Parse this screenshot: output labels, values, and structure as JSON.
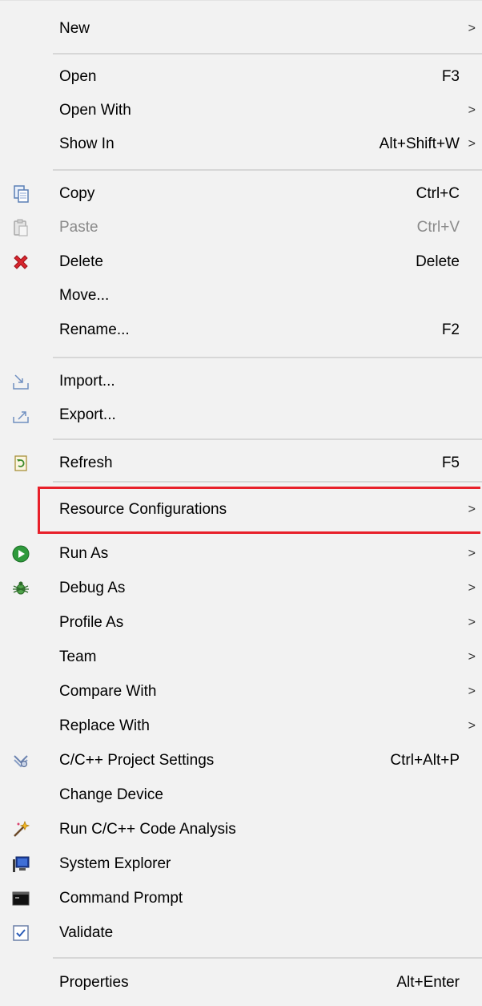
{
  "menu": {
    "items": [
      {
        "label": "New",
        "shortcut": "",
        "submenu": true,
        "icon": null
      },
      {
        "label": "Open",
        "shortcut": "F3",
        "submenu": false,
        "icon": null
      },
      {
        "label": "Open With",
        "shortcut": "",
        "submenu": true,
        "icon": null
      },
      {
        "label": "Show In",
        "shortcut": "Alt+Shift+W",
        "submenu": true,
        "icon": null
      },
      {
        "label": "Copy",
        "shortcut": "Ctrl+C",
        "submenu": false,
        "icon": "copy-icon"
      },
      {
        "label": "Paste",
        "shortcut": "Ctrl+V",
        "submenu": false,
        "icon": "paste-icon",
        "disabled": true
      },
      {
        "label": "Delete",
        "shortcut": "Delete",
        "submenu": false,
        "icon": "delete-icon"
      },
      {
        "label": "Move...",
        "shortcut": "",
        "submenu": false,
        "icon": null
      },
      {
        "label": "Rename...",
        "shortcut": "F2",
        "submenu": false,
        "icon": null
      },
      {
        "label": "Import...",
        "shortcut": "",
        "submenu": false,
        "icon": "import-icon"
      },
      {
        "label": "Export...",
        "shortcut": "",
        "submenu": false,
        "icon": "export-icon"
      },
      {
        "label": "Refresh",
        "shortcut": "F5",
        "submenu": false,
        "icon": "refresh-icon"
      },
      {
        "label": "Resource Configurations",
        "shortcut": "",
        "submenu": true,
        "icon": null,
        "highlighted": true
      },
      {
        "label": "Run As",
        "shortcut": "",
        "submenu": true,
        "icon": "run-icon"
      },
      {
        "label": "Debug As",
        "shortcut": "",
        "submenu": true,
        "icon": "debug-bug-icon"
      },
      {
        "label": "Profile As",
        "shortcut": "",
        "submenu": true,
        "icon": null
      },
      {
        "label": "Team",
        "shortcut": "",
        "submenu": true,
        "icon": null
      },
      {
        "label": "Compare With",
        "shortcut": "",
        "submenu": true,
        "icon": null
      },
      {
        "label": "Replace With",
        "shortcut": "",
        "submenu": true,
        "icon": null
      },
      {
        "label": "C/C++ Project Settings",
        "shortcut": "Ctrl+Alt+P",
        "submenu": false,
        "icon": "project-settings-icon"
      },
      {
        "label": "Change Device",
        "shortcut": "",
        "submenu": false,
        "icon": null
      },
      {
        "label": "Run C/C++ Code Analysis",
        "shortcut": "",
        "submenu": false,
        "icon": "code-analysis-wand-icon"
      },
      {
        "label": "System Explorer",
        "shortcut": "",
        "submenu": false,
        "icon": "system-explorer-icon"
      },
      {
        "label": "Command Prompt",
        "shortcut": "",
        "submenu": false,
        "icon": "command-prompt-icon"
      },
      {
        "label": "Validate",
        "shortcut": "",
        "submenu": false,
        "icon": "validate-checkbox-icon"
      },
      {
        "label": "Properties",
        "shortcut": "Alt+Enter",
        "submenu": false,
        "icon": null
      }
    ],
    "submenu_arrow": ">",
    "highlight_color": "#e8202a"
  }
}
